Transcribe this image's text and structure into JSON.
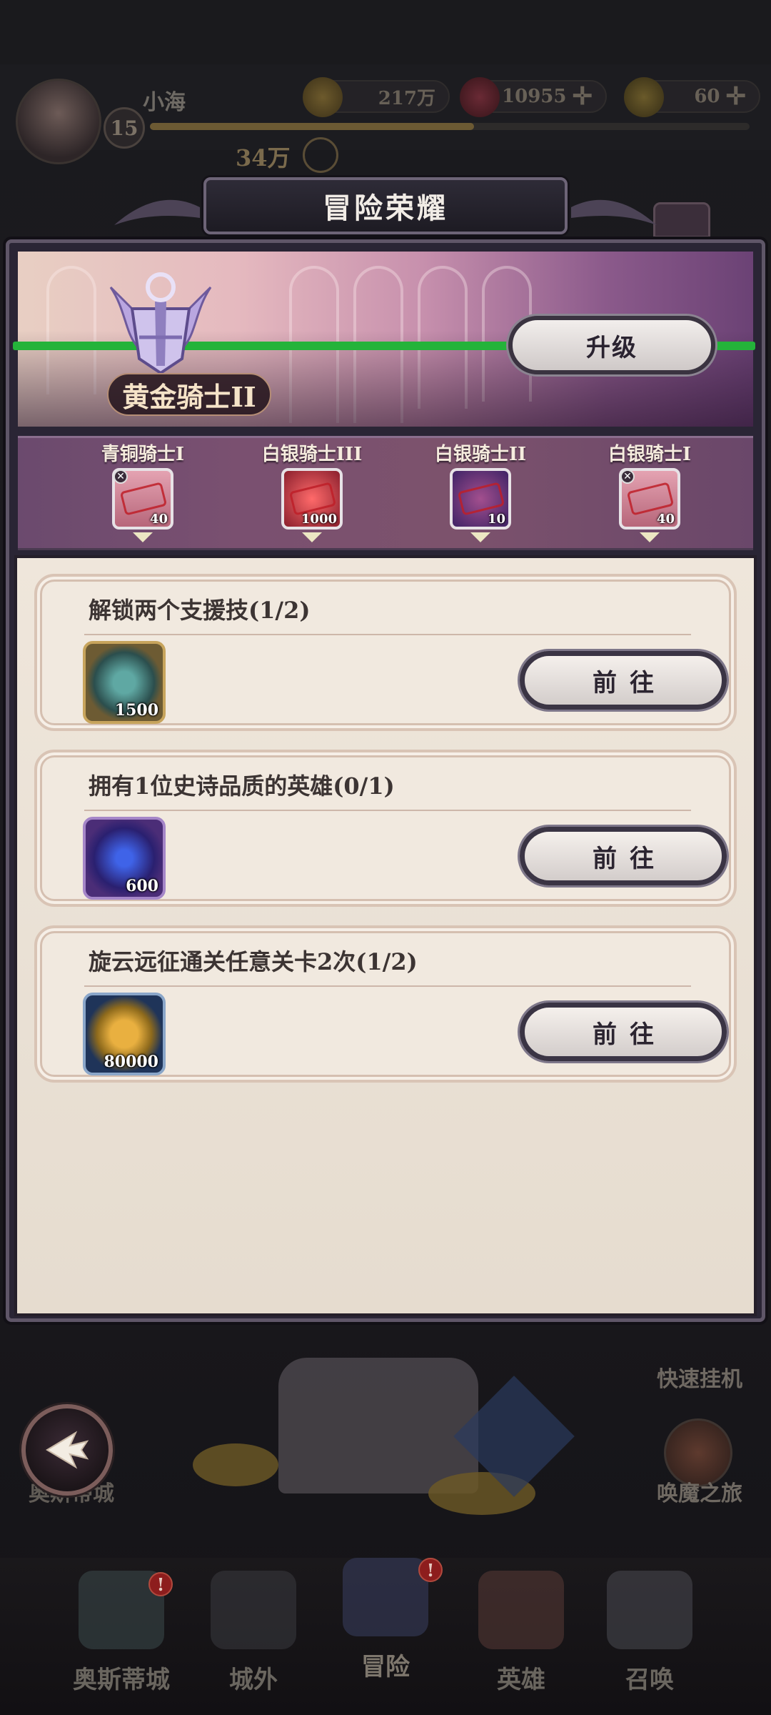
{
  "hud": {
    "player_name": "小海",
    "level": "15",
    "xp_progress": 0.54,
    "gold": "217万",
    "gems": "10955",
    "gems_plus": "✛",
    "tokens": "60",
    "tokens_plus": "✛",
    "power": "34万"
  },
  "modal": {
    "title": "冒险荣耀",
    "current_rank": "黄金骑士II",
    "upgrade_label": "升级",
    "track": [
      {
        "label": "青铜骑士I",
        "qty": "40",
        "item": "hero-card"
      },
      {
        "label": "白银骑士III",
        "qty": "1000",
        "item": "red-gem"
      },
      {
        "label": "白银骑士II",
        "qty": "10",
        "item": "purple-card"
      },
      {
        "label": "白银骑士I",
        "qty": "40",
        "item": "hero-card"
      }
    ],
    "tasks": [
      {
        "title": "解锁两个支援技(1/2)",
        "reward_qty": "1500",
        "reward_icon": "support-orb-icon",
        "button": "前往"
      },
      {
        "title": "拥有1位史诗品质的英雄(0/1)",
        "reward_qty": "600",
        "reward_icon": "blue-crystal-icon",
        "button": "前往"
      },
      {
        "title": "旋云远征通关任意关卡2次(1/2)",
        "reward_qty": "80000",
        "reward_icon": "gold-coin-icon",
        "button": "前往"
      }
    ]
  },
  "side": {
    "quick_idle": "快速挂机",
    "summon_journey": "唤魔之旅",
    "back_label": "奥斯蒂城"
  },
  "nav": {
    "items": [
      {
        "label": "奥斯蒂城",
        "alert": "!"
      },
      {
        "label": "城外"
      },
      {
        "label": "冒险",
        "alert": "!"
      },
      {
        "label": "英雄"
      },
      {
        "label": "召唤"
      }
    ]
  },
  "colors": {
    "progress_green": "#24b33a",
    "panel_bg": "#efe6db",
    "modal_frame": "#2a2535"
  }
}
